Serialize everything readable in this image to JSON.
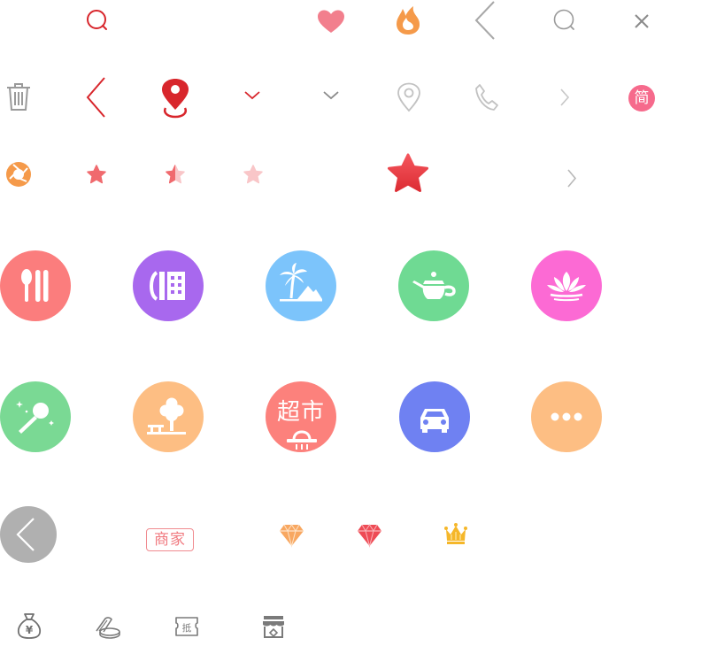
{
  "icons": {
    "simplified_label": "简",
    "supermarket_label": "超市",
    "merchant_label": "商家",
    "coupon_label": "抵",
    "currency_label": "¥"
  },
  "colors": {
    "red": "#d8262c",
    "pink_heart": "#f27f8d",
    "orange_flame": "#f59a4a",
    "gray": "#a8a8a8",
    "light_gray": "#d3d3d3",
    "star_red": "#f06a6e",
    "dining": "#fb7d7d",
    "hotel": "#a868ee",
    "scenic": "#7cc4fb",
    "tea": "#6fda93",
    "spa": "#fc6ad4",
    "ktv": "#7ad994",
    "park": "#fdbe83",
    "supermarket": "#fc817c",
    "car": "#6f81f2",
    "more": "#fdbe83",
    "back_circle": "#b0b0b0"
  }
}
